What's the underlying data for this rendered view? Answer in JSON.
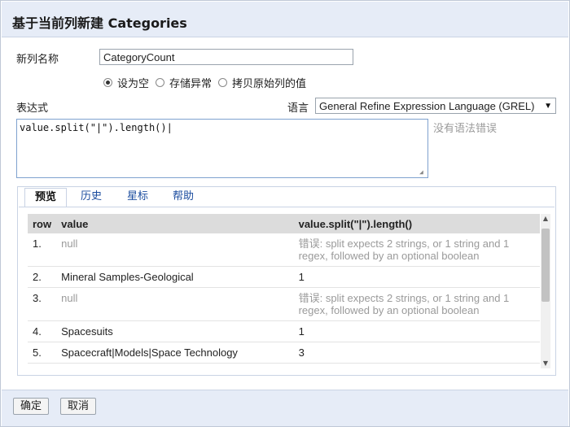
{
  "dialog": {
    "title": "基于当前列新建 Categories"
  },
  "form": {
    "name_label": "新列名称",
    "name_value": "CategoryCount",
    "on_error_options": [
      {
        "label": "设为空",
        "checked": true
      },
      {
        "label": "存储异常",
        "checked": false
      },
      {
        "label": "拷贝原始列的值",
        "checked": false
      }
    ],
    "expression_label": "表达式",
    "language_label": "语言",
    "language_value": "General Refine Expression Language (GREL)",
    "expression_value": "value.split(\"|\").length()",
    "status_text": "没有语法错误"
  },
  "tabs": [
    {
      "label": "预览",
      "active": true
    },
    {
      "label": "历史",
      "active": false
    },
    {
      "label": "星标",
      "active": false
    },
    {
      "label": "帮助",
      "active": false
    }
  ],
  "preview": {
    "columns": [
      "row",
      "value",
      "value.split(\"|\").length()"
    ],
    "rows": [
      {
        "row": "1.",
        "value": "null",
        "value_is_null": true,
        "result": "错误: split expects 2 strings, or 1 string and 1 regex, followed by an optional boolean",
        "result_is_error": true
      },
      {
        "row": "2.",
        "value": "Mineral Samples-Geological",
        "value_is_null": false,
        "result": "1",
        "result_is_error": false
      },
      {
        "row": "3.",
        "value": "null",
        "value_is_null": true,
        "result": "错误: split expects 2 strings, or 1 string and 1 regex, followed by an optional boolean",
        "result_is_error": true
      },
      {
        "row": "4.",
        "value": "Spacesuits",
        "value_is_null": false,
        "result": "1",
        "result_is_error": false
      },
      {
        "row": "5.",
        "value": "Spacecraft|Models|Space Technology",
        "value_is_null": false,
        "result": "3",
        "result_is_error": false
      }
    ]
  },
  "buttons": {
    "ok": "确定",
    "cancel": "取消"
  }
}
